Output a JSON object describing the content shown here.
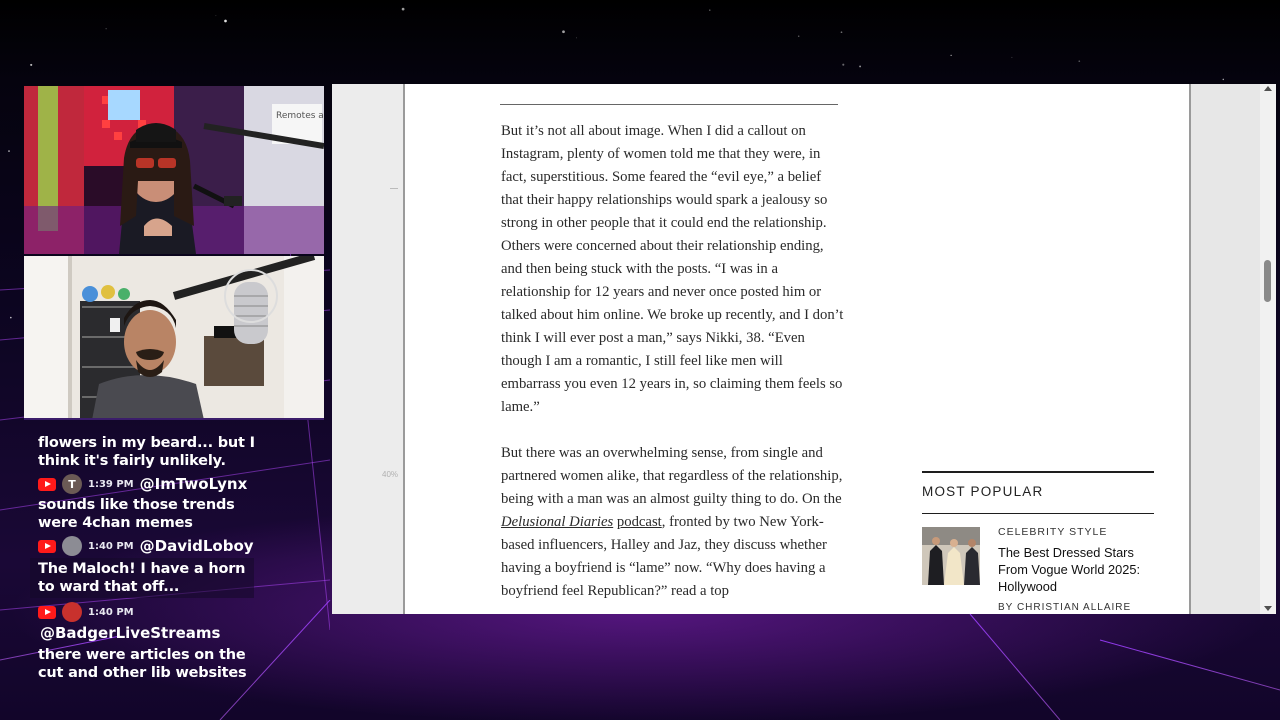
{
  "article": {
    "paragraphs": [
      [
        {
          "t": "But it’s not all about image. When I did a callout on Instagram, plenty of women told me that they were, in fact, superstitious. Some feared the “evil eye,” a belief that their happy relationships would spark a jealousy so strong in other people that it could end the relationship. Others were concerned about their relationship ending, and then being stuck with the posts. “I was in a relationship for 12 years and never once posted him or talked about him online. We broke up recently, and I don’t think I will ever post a man,” says Nikki, 38. “Even though I am a romantic, I still feel like men will embarrass you even 12 years in, so claiming them feels so lame.”"
        }
      ],
      [
        {
          "t": "But there was an overwhelming sense, from single and partnered women alike, that regardless of the relationship, being with a man was an almost guilty thing to do. On the "
        },
        {
          "t": "Delusional Diaries",
          "s": "em"
        },
        {
          "t": " "
        },
        {
          "t": "podcast",
          "s": "ul"
        },
        {
          "t": ", fronted by two New York-based influencers, Halley and Jaz, they discuss whether having a boyfriend is “lame” now. “Why does having a boyfriend feel Republican?” read a top"
        }
      ]
    ],
    "margin_marker": "40%"
  },
  "most_popular": {
    "heading": "MOST POPULAR",
    "category": "CELEBRITY STYLE",
    "title": "The Best Dressed Stars From Vogue World 2025: Hollywood",
    "byline": "BY CHRISTIAN ALLAIRE"
  },
  "chat": {
    "messages": [
      {
        "type": "text",
        "text": "flowers in my beard... but I think it's fairly unlikely.",
        "boxed": false
      },
      {
        "type": "header",
        "platform": "youtube-icon",
        "avatar_letter": "T",
        "avatar_color": "#6b5a55",
        "time": "1:39 PM",
        "user": "@ImTwoLynx"
      },
      {
        "type": "text",
        "text": "sounds like those trends were 4chan memes",
        "boxed": false
      },
      {
        "type": "header",
        "platform": "youtube-icon",
        "avatar_letter": "",
        "avatar_color": "#8c8c94",
        "time": "1:40 PM",
        "user": "@DavidLoboy"
      },
      {
        "type": "text",
        "text": "The Maloch! I have a horn to ward that off...",
        "boxed": true
      },
      {
        "type": "header",
        "platform": "youtube-icon",
        "avatar_letter": "",
        "avatar_color": "#c8312d",
        "time": "1:40 PM",
        "user": ""
      },
      {
        "type": "user-line",
        "user": "@BadgerLiveStreams"
      },
      {
        "type": "text",
        "text": "there were articles on the cut and other lib websites",
        "boxed": false
      }
    ]
  },
  "webcam": {
    "sign_text": "Remotes are Gal. Stuff"
  },
  "colors": {
    "youtube": "#ff1a1a",
    "neon_grid": "#d04dff",
    "page_bg": "#ffffff"
  }
}
